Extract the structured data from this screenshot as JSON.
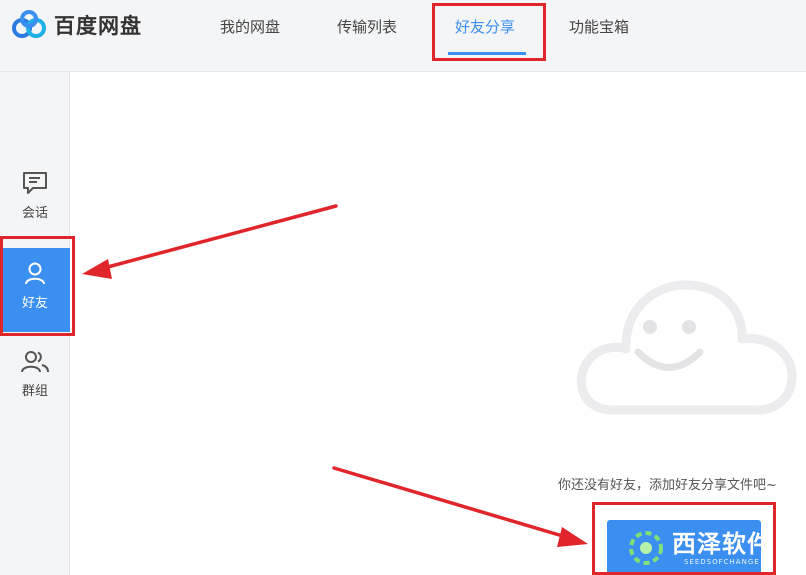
{
  "app": {
    "name": "百度网盘"
  },
  "nav": {
    "items": [
      {
        "label": "我的网盘",
        "active": false
      },
      {
        "label": "传输列表",
        "active": false
      },
      {
        "label": "好友分享",
        "active": true
      },
      {
        "label": "功能宝箱",
        "active": false
      }
    ]
  },
  "sidebar": {
    "items": [
      {
        "label": "会话",
        "icon": "chat-icon",
        "active": false
      },
      {
        "label": "好友",
        "icon": "person-icon",
        "active": true
      },
      {
        "label": "群组",
        "icon": "group-icon",
        "active": false
      }
    ]
  },
  "empty_state": {
    "message": "你还没有好友，添加好友分享文件吧~"
  },
  "watermark": {
    "main": "西泽软件",
    "sub": "SEEDSOFCHANGE"
  },
  "colors": {
    "accent": "#3a8ff0",
    "annotation_red": "#e0262b"
  }
}
